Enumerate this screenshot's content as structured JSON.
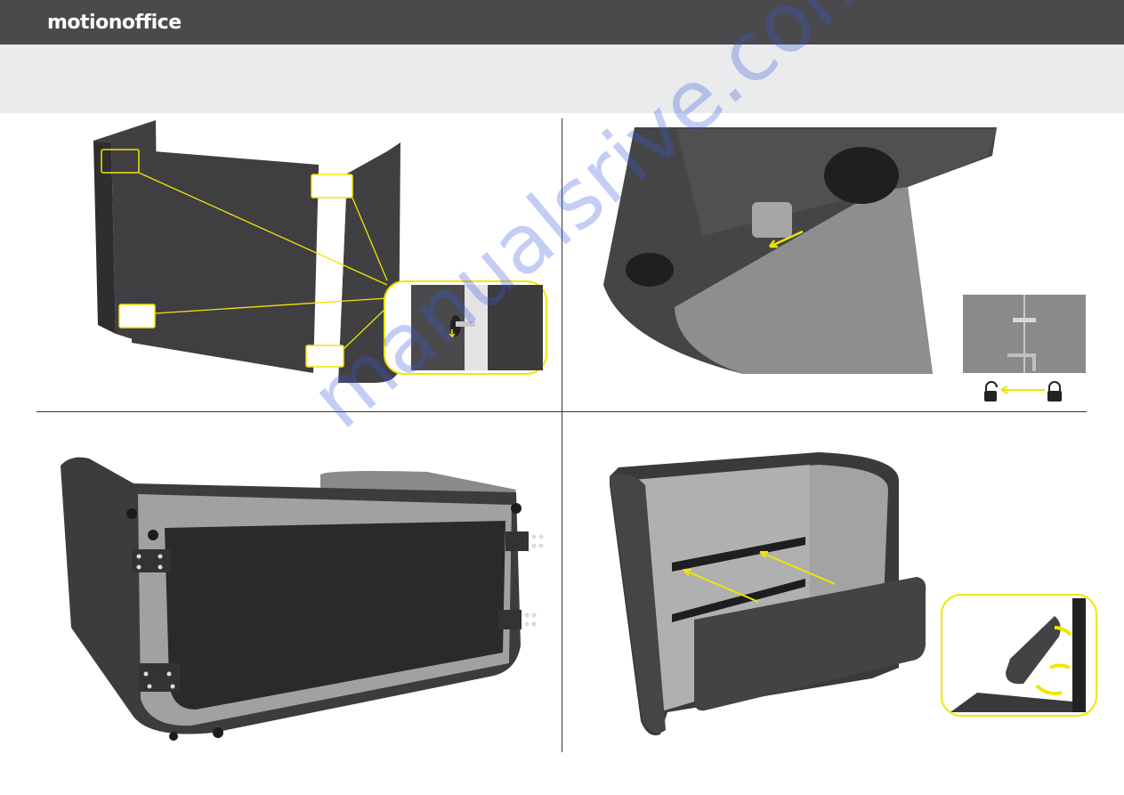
{
  "brand": {
    "name": "motionoffice"
  },
  "watermark": {
    "text": "manualsrive.com"
  },
  "colors": {
    "header_bg": "#4a4a4c",
    "band_bg": "#e9ebec",
    "accent_yellow": "#f2e600",
    "felt_dark": "#3f3f41",
    "felt_light": "#9c9c9c"
  },
  "icons": [
    "unlocked-padlock-icon",
    "locked-padlock-icon",
    "yellow-arrow-icon"
  ]
}
